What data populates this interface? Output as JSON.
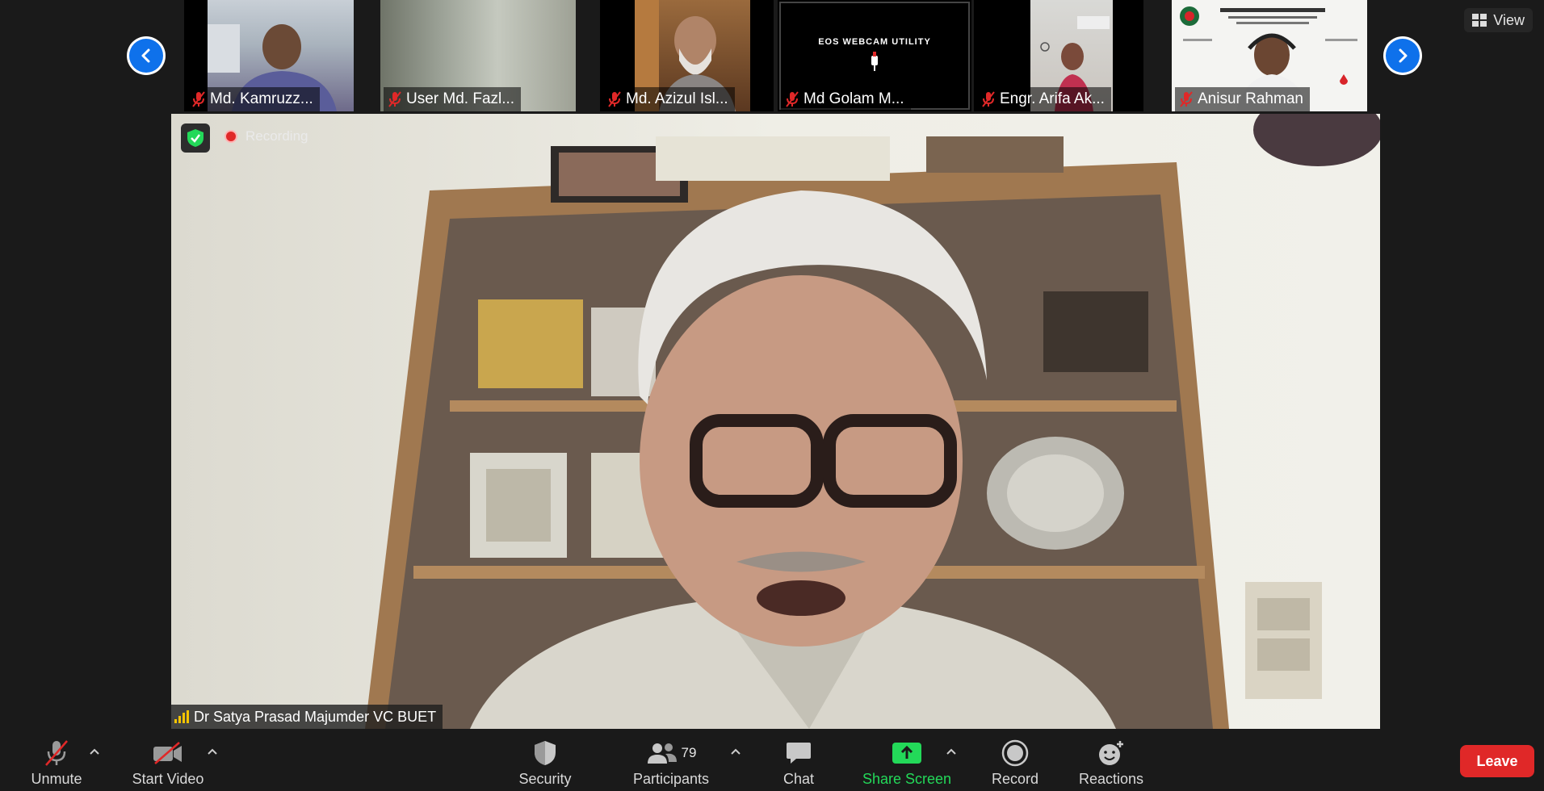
{
  "view_button": {
    "label": "View"
  },
  "participants_strip": [
    {
      "name": "Md. Kamruzz..."
    },
    {
      "name": "User Md. Fazl..."
    },
    {
      "name": "Md. Azizul Isl..."
    },
    {
      "name": "Md Golam M..."
    },
    {
      "name": "Engr. Arifa Ak..."
    },
    {
      "name": "Anisur Rahman"
    }
  ],
  "webcam_placeholder": {
    "text": "EOS WEBCAM UTILITY"
  },
  "main_video": {
    "recording_label": "Recording",
    "speaker_name": "Dr Satya Prasad Majumder VC BUET"
  },
  "toolbar": {
    "unmute": "Unmute",
    "start_video": "Start Video",
    "security": "Security",
    "participants": "Participants",
    "participants_count": "79",
    "chat": "Chat",
    "share_screen": "Share Screen",
    "record": "Record",
    "reactions": "Reactions",
    "leave": "Leave"
  },
  "colors": {
    "background": "#1a1a1a",
    "accent_blue": "#0e71eb",
    "share_green": "#23d959",
    "leave_red": "#e02828",
    "mute_red": "#e02828"
  },
  "icons": [
    "chevron-left-icon",
    "chevron-right-icon",
    "grid-icon",
    "muted-mic-icon",
    "shield-check-icon",
    "signal-icon",
    "video-off-icon",
    "security-shield-icon",
    "participants-icon",
    "chat-icon",
    "share-screen-icon",
    "record-icon",
    "reactions-icon",
    "caret-up-icon"
  ]
}
